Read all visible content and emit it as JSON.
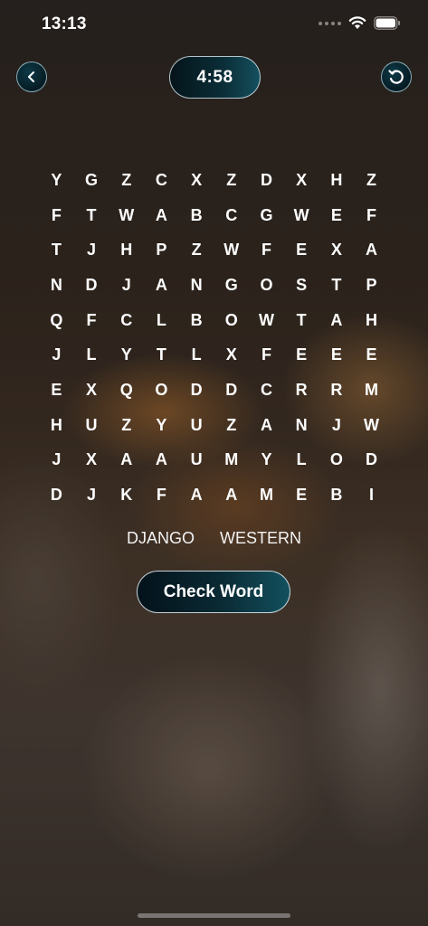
{
  "status": {
    "time": "13:13",
    "icons": [
      "signal-icon",
      "wifi-icon",
      "battery-icon"
    ]
  },
  "header": {
    "timer": "4:58",
    "back_icon": "chevron-left-icon",
    "restart_icon": "restart-icon"
  },
  "grid": [
    [
      "Y",
      "G",
      "Z",
      "C",
      "X",
      "Z",
      "D",
      "X",
      "H",
      "Z"
    ],
    [
      "F",
      "T",
      "W",
      "A",
      "B",
      "C",
      "G",
      "W",
      "E",
      "F"
    ],
    [
      "T",
      "J",
      "H",
      "P",
      "Z",
      "W",
      "F",
      "E",
      "X",
      "A"
    ],
    [
      "N",
      "D",
      "J",
      "A",
      "N",
      "G",
      "O",
      "S",
      "T",
      "P"
    ],
    [
      "Q",
      "F",
      "C",
      "L",
      "B",
      "O",
      "W",
      "T",
      "A",
      "H"
    ],
    [
      "J",
      "L",
      "Y",
      "T",
      "L",
      "X",
      "F",
      "E",
      "E",
      "E"
    ],
    [
      "E",
      "X",
      "Q",
      "O",
      "D",
      "D",
      "C",
      "R",
      "R",
      "M"
    ],
    [
      "H",
      "U",
      "Z",
      "Y",
      "U",
      "Z",
      "A",
      "N",
      "J",
      "W"
    ],
    [
      "J",
      "X",
      "A",
      "A",
      "U",
      "M",
      "Y",
      "L",
      "O",
      "D"
    ],
    [
      "D",
      "J",
      "K",
      "F",
      "A",
      "A",
      "M",
      "E",
      "B",
      "I"
    ]
  ],
  "words": [
    "DJANGO",
    "WESTERN"
  ],
  "actions": {
    "check_word_label": "Check Word"
  },
  "colors": {
    "button_dark": "#061c24",
    "button_teal": "#13505e",
    "text": "#ffffff"
  }
}
